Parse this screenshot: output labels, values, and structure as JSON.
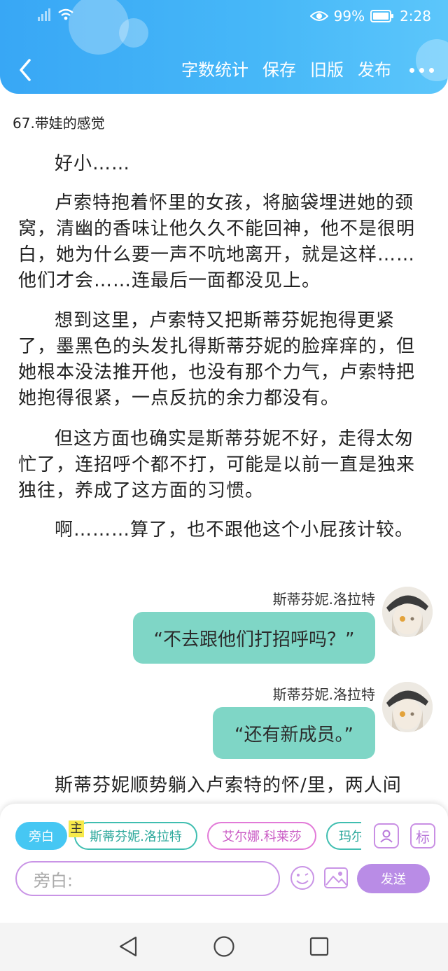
{
  "status_bar": {
    "battery_text": "99%",
    "time": "2:28"
  },
  "header": {
    "actions": [
      "字数统计",
      "保存",
      "旧版",
      "发布"
    ]
  },
  "content": {
    "chapter_title": "67.带娃的感觉",
    "paragraphs": [
      "好小……",
      "卢索特抱着怀里的女孩，将脑袋埋进她的颈窝，清幽的香味让他久久不能回神，他不是很明白，她为什么要一声不吭地离开，就是这样……他们才会……连最后一面都没见上。",
      "想到这里，卢索特又把斯蒂芬妮抱得更紧了，墨黑色的头发扎得斯蒂芬妮的脸痒痒的，但她根本没法推开他，也没有那个力气，卢索特把她抱得很紧，一点反抗的余力都没有。",
      "但这方面也确实是斯蒂芬妮不好，走得太匆忙了，连招呼个都不打，可能是以前一直是独来独往，养成了这方面的习惯。",
      "啊………算了，也不跟他这个小屁孩计较。"
    ],
    "messages": [
      {
        "name": "斯蒂芬妮.洛拉特",
        "text": "“不去跟他们打招呼吗？”"
      },
      {
        "name": "斯蒂芬妮.洛拉特",
        "text": "“还有新成员。”"
      }
    ],
    "trailing_paragraph": "斯蒂芬妮顺势躺入卢索特的怀/里，两人间"
  },
  "input_panel": {
    "narration_chip": "旁白",
    "main_tag": "主",
    "characters": [
      "斯蒂芬妮.洛拉特",
      "艾尔娜.科莱莎",
      "玛尔"
    ],
    "tag_button": "标",
    "input_placeholder": "旁白:",
    "send_label": "发送"
  },
  "colors": {
    "header": "#3fb0f7",
    "bubble": "#7fd6c6",
    "narration_chip": "#46c7f3",
    "send_button": "#b98ce6"
  },
  "icons": [
    "wifi-icon",
    "eye-icon",
    "battery-icon",
    "back-arrow-icon",
    "more-icon",
    "person-icon",
    "emoji-icon",
    "image-icon",
    "nav-back-icon",
    "nav-home-icon",
    "nav-recent-icon"
  ]
}
